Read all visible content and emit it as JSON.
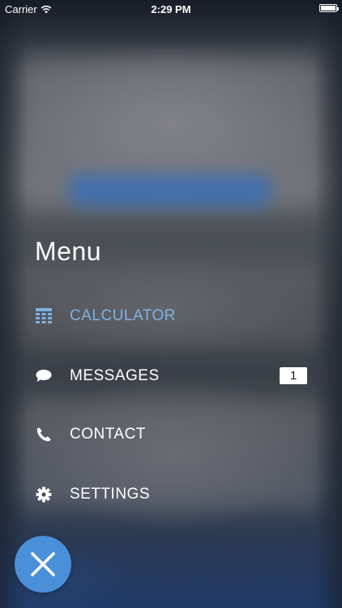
{
  "status_bar": {
    "carrier": "Carrier",
    "time": "2:29 PM",
    "battery_level": 1.0
  },
  "menu": {
    "title": "Menu",
    "items": [
      {
        "label": "CALCULATOR",
        "icon": "calculator-icon",
        "active": true
      },
      {
        "label": "MESSAGES",
        "icon": "chat-bubble-icon",
        "badge": "1"
      },
      {
        "label": "CONTACT",
        "icon": "phone-icon"
      },
      {
        "label": "SETTINGS",
        "icon": "gear-icon"
      }
    ]
  },
  "colors": {
    "accent": "#7fb2e5",
    "fab": "#4a90d9",
    "text": "#ffffff"
  },
  "close_button": {
    "icon": "close-icon"
  }
}
